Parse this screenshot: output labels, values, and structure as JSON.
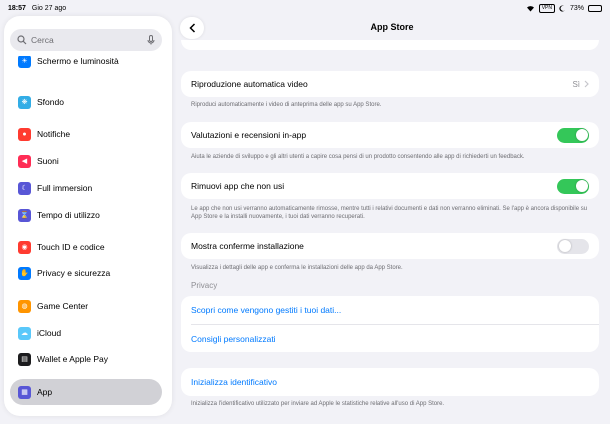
{
  "status": {
    "time": "18:57",
    "date": "Gio 27 ago",
    "vpn": "VPN",
    "battery": "73%",
    "battery_level": 0.73
  },
  "sidebar": {
    "search_placeholder": "Cerca",
    "partial_item": "Schermo e luminosità",
    "items": [
      {
        "label": "Sfondo",
        "icon": "wallpaper-icon",
        "color": "#32ade6"
      },
      {
        "label": "Notifiche",
        "icon": "bell-icon",
        "color": "#ff3b30"
      },
      {
        "label": "Suoni",
        "icon": "speaker-icon",
        "color": "#ff2d55"
      },
      {
        "label": "Full immersion",
        "icon": "moon-icon",
        "color": "#5856d6"
      },
      {
        "label": "Tempo di utilizzo",
        "icon": "hourglass-icon",
        "color": "#5856d6"
      },
      {
        "label": "Touch ID e codice",
        "icon": "fingerprint-icon",
        "color": "#ff3b30"
      },
      {
        "label": "Privacy e sicurezza",
        "icon": "hand-icon",
        "color": "#007aff"
      },
      {
        "label": "Game Center",
        "icon": "game-center-icon",
        "color": "#ff9500"
      },
      {
        "label": "iCloud",
        "icon": "cloud-icon",
        "color": "#5ac8fa"
      },
      {
        "label": "Wallet e Apple Pay",
        "icon": "wallet-icon",
        "color": "#1c1c1e"
      },
      {
        "label": "App",
        "icon": "apps-icon",
        "color": "#5856d6"
      }
    ]
  },
  "header": {
    "title": "App Store"
  },
  "settings": {
    "autoplay": {
      "label": "Riproduzione automatica video",
      "value": "Sì",
      "note": "Riproduci automaticamente i video di anteprima delle app su App Store."
    },
    "ratings": {
      "label": "Valutazioni e recensioni in-app",
      "on": true,
      "note": "Aiuta le aziende di sviluppo e gli altri utenti a capire cosa pensi di un prodotto consentendo alle app di richiederti un feedback."
    },
    "offload": {
      "label": "Rimuovi app che non usi",
      "on": true,
      "note": "Le app che non usi verranno automaticamente rimosse, mentre tutti i relativi documenti e dati non verranno eliminati. Se l'app è ancora disponibile su App Store e la installi nuovamente, i tuoi dati verranno recuperati."
    },
    "confirm": {
      "label": "Mostra conferme installazione",
      "on": false,
      "note": "Visualizza i dettagli delle app e conferma le installazioni delle app da App Store."
    }
  },
  "privacy": {
    "header": "Privacy",
    "link1": "Scopri come vengono gestiti i tuoi dati...",
    "link2": "Consigli personalizzati"
  },
  "identifier": {
    "link": "Inizializza identificativo",
    "note": "Inizializza l'identificativo utilizzato per inviare ad Apple le statistiche relative all'uso di App Store."
  }
}
